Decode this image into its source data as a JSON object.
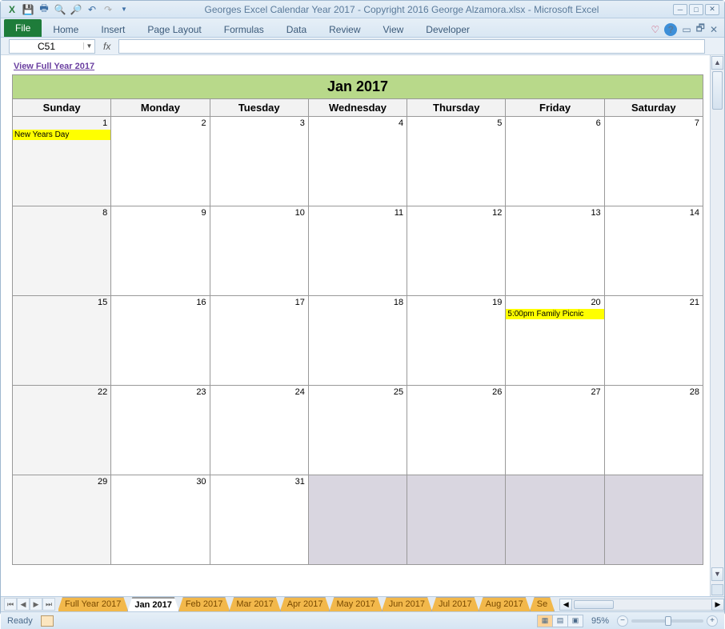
{
  "titlebar": {
    "title": "Georges Excel Calendar Year 2017 - Copyright 2016 George Alzamora.xlsx - Microsoft Excel"
  },
  "ribbon": {
    "file": "File",
    "tabs": [
      "Home",
      "Insert",
      "Page Layout",
      "Formulas",
      "Data",
      "Review",
      "View",
      "Developer"
    ]
  },
  "namebox": "C51",
  "fx": "fx",
  "view_link": "View Full Year 2017",
  "calendar": {
    "title": "Jan 2017",
    "days": [
      "Sunday",
      "Monday",
      "Tuesday",
      "Wednesday",
      "Thursday",
      "Friday",
      "Saturday"
    ],
    "weeks": [
      [
        {
          "n": "1",
          "event": "New Years Day",
          "sunday": true
        },
        {
          "n": "2"
        },
        {
          "n": "3"
        },
        {
          "n": "4"
        },
        {
          "n": "5"
        },
        {
          "n": "6"
        },
        {
          "n": "7"
        }
      ],
      [
        {
          "n": "8",
          "sunday": true
        },
        {
          "n": "9"
        },
        {
          "n": "10"
        },
        {
          "n": "11"
        },
        {
          "n": "12"
        },
        {
          "n": "13"
        },
        {
          "n": "14"
        }
      ],
      [
        {
          "n": "15",
          "sunday": true
        },
        {
          "n": "16"
        },
        {
          "n": "17"
        },
        {
          "n": "18"
        },
        {
          "n": "19"
        },
        {
          "n": "20",
          "event": "5:00pm Family Picnic"
        },
        {
          "n": "21"
        }
      ],
      [
        {
          "n": "22",
          "sunday": true
        },
        {
          "n": "23"
        },
        {
          "n": "24"
        },
        {
          "n": "25"
        },
        {
          "n": "26"
        },
        {
          "n": "27"
        },
        {
          "n": "28"
        }
      ],
      [
        {
          "n": "29",
          "sunday": true
        },
        {
          "n": "30"
        },
        {
          "n": "31"
        },
        {
          "grey": true
        },
        {
          "grey": true
        },
        {
          "grey": true
        },
        {
          "grey": true
        }
      ]
    ]
  },
  "sheet_tabs": [
    "Full Year 2017",
    "Jan 2017",
    "Feb 2017",
    "Mar 2017",
    "Apr 2017",
    "May 2017",
    "Jun 2017",
    "Jul 2017",
    "Aug 2017",
    "Se"
  ],
  "active_sheet": "Jan 2017",
  "status": {
    "ready": "Ready",
    "zoom": "95%"
  }
}
